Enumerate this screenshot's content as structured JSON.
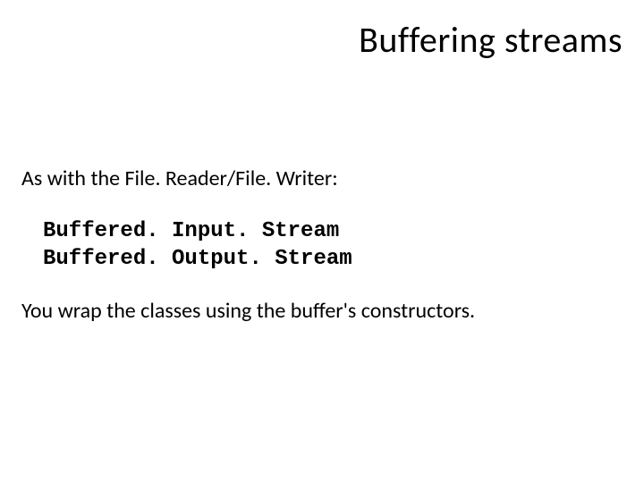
{
  "title": "Buffering streams",
  "intro": "As with the File. Reader/File. Writer:",
  "code": {
    "line1": "Buffered. Input. Stream",
    "line2": "Buffered. Output. Stream"
  },
  "outro": "You wrap the classes using the buffer's constructors."
}
